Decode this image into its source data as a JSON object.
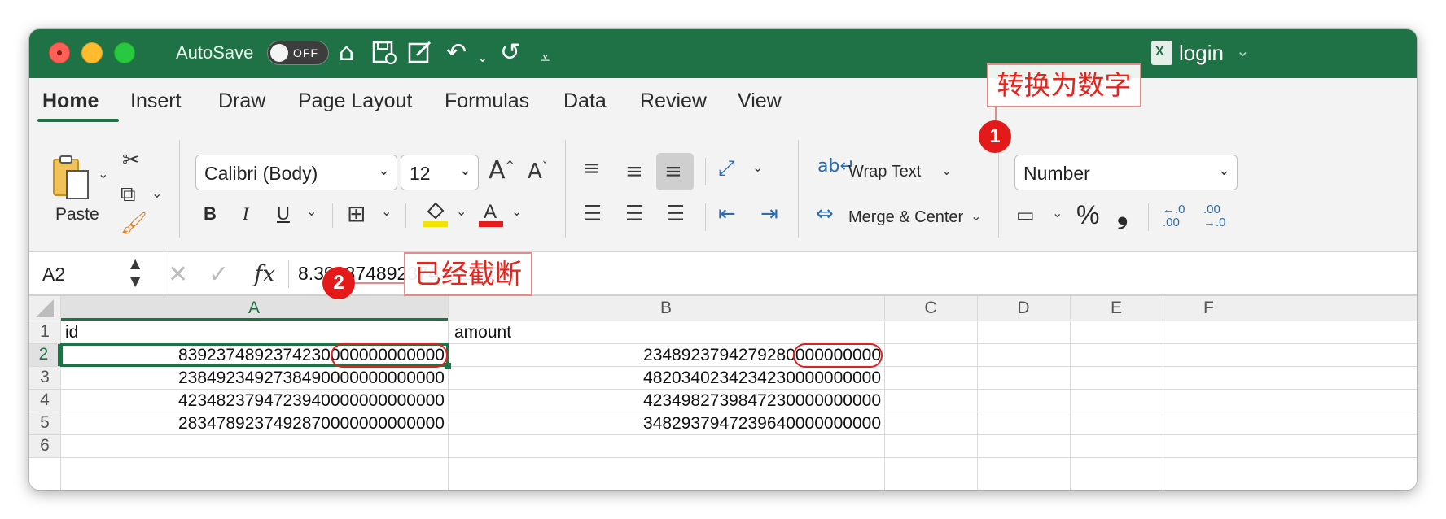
{
  "window": {
    "autosave_label": "AutoSave",
    "autosave_state": "OFF",
    "document_title": "login",
    "accent": "#1f7246"
  },
  "tabs": [
    "Home",
    "Insert",
    "Draw",
    "Page Layout",
    "Formulas",
    "Data",
    "Review",
    "View"
  ],
  "active_tab": "Home",
  "ribbon": {
    "paste_label": "Paste",
    "font_name": "Calibri (Body)",
    "font_size": "12",
    "bold_label": "B",
    "italic_label": "I",
    "underline_label": "U",
    "wrap_text_label": "Wrap Text",
    "merge_center_label": "Merge & Center",
    "number_format": "Number",
    "percent_label": "%",
    "comma_label": "❟",
    "increase_decimal_label": "←.0 .00",
    "decrease_decimal_label": ".00 →.0"
  },
  "formula_bar": {
    "name_box": "A2",
    "fx_label": "fx",
    "formula": "8.39237489237423E+27"
  },
  "sheet": {
    "columns": [
      "A",
      "B",
      "C",
      "D",
      "E",
      "F"
    ],
    "rows": [
      "1",
      "2",
      "3",
      "4",
      "5",
      "6"
    ],
    "cells": {
      "A1": "id",
      "B1": "amount",
      "A2": "8392374892374230000000000000",
      "B2": "2348923794279280000000000",
      "A3": "2384923492738490000000000000",
      "B3": "4820340234234230000000000",
      "A4": "4234823794723940000000000000",
      "B4": "4234982739847230000000000",
      "A5": "2834789237492870000000000000",
      "B5": "3482937947239640000000000"
    },
    "selected_cell": "A2"
  },
  "annotations": {
    "note1_number": "1",
    "note1_text": "转换为数字",
    "note2_number": "2",
    "note2_text": "已经截断",
    "color": "#e8231c"
  }
}
